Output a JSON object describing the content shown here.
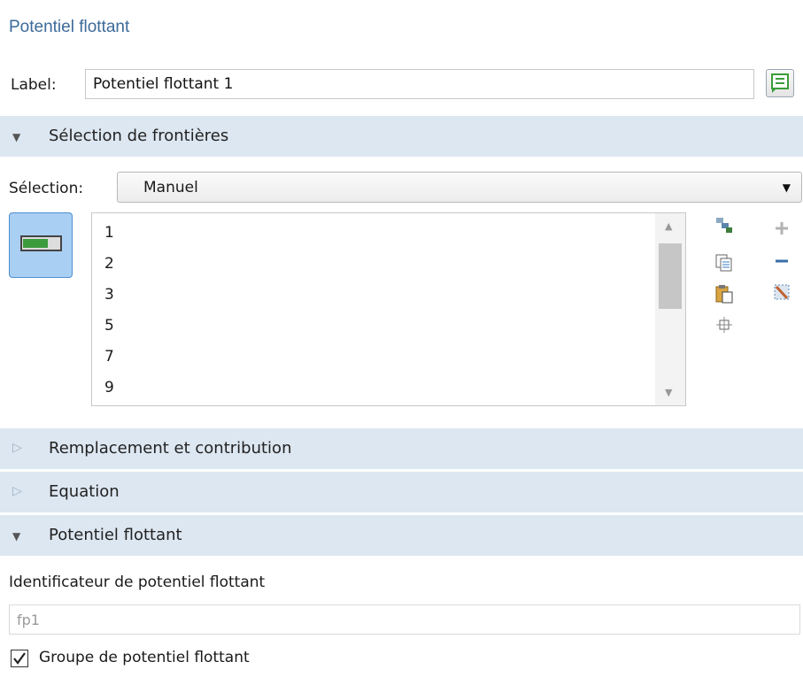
{
  "panel": {
    "title": "Potentiel flottant"
  },
  "label_row": {
    "label": "Label:",
    "value": "Potentiel flottant 1",
    "button_icon": "rename-icon"
  },
  "sections": {
    "boundary_selection": {
      "title": "Sélection de frontières",
      "expanded": true
    },
    "override": {
      "title": "Remplacement et contribution",
      "expanded": false
    },
    "equation": {
      "title": "Equation",
      "expanded": false
    },
    "floating_potential": {
      "title": "Potentiel flottant",
      "expanded": true
    }
  },
  "selection": {
    "label": "Sélection:",
    "mode": "Manuel",
    "items": [
      "1",
      "2",
      "3",
      "5",
      "7",
      "9"
    ],
    "side_icons": [
      "paste-selection-icon",
      "copy-icon",
      "paste-icon",
      "zoom-selected-icon",
      "add-icon",
      "remove-icon",
      "clear-selection-icon"
    ]
  },
  "floating": {
    "identifier_label": "Identificateur de potentiel flottant",
    "identifier_value": "fp1",
    "group_label": "Groupe de potentiel flottant",
    "group_checked": true
  },
  "colors": {
    "title": "#3d6a99",
    "section_bg": "#dde7f1",
    "toggle_active": "#a9cff3"
  }
}
